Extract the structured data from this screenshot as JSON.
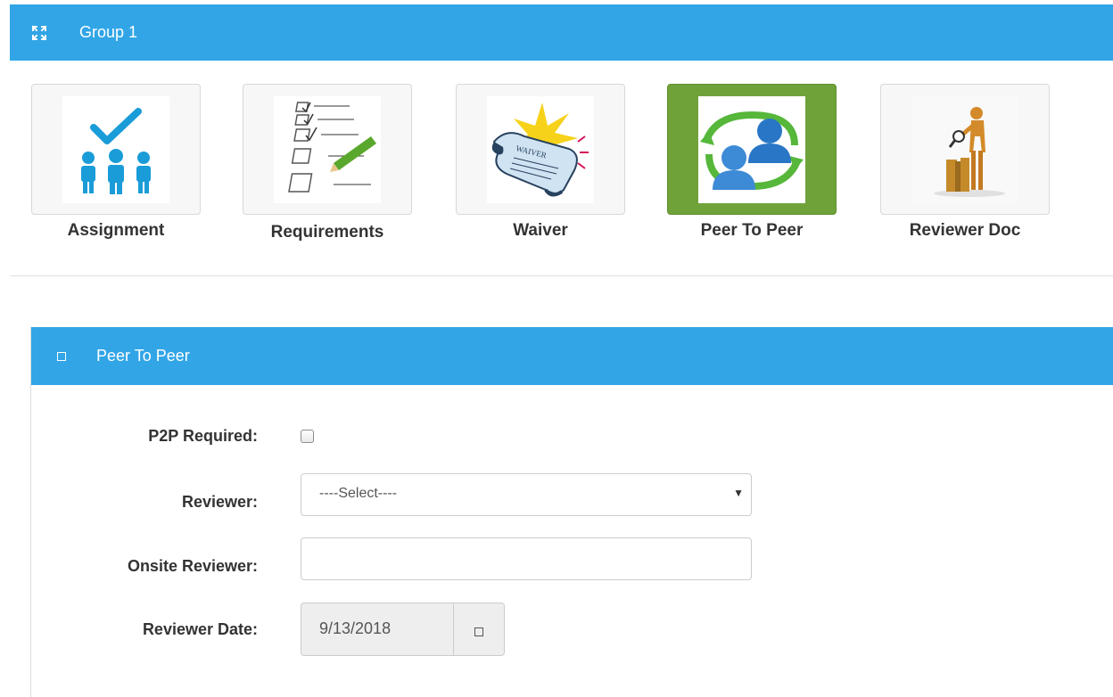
{
  "group": {
    "title": "Group 1",
    "icon": "expand-icon"
  },
  "tiles": [
    {
      "label": "Assignment",
      "icon": "assignment-icon",
      "active": false
    },
    {
      "label": "Requirements",
      "icon": "requirements-icon",
      "active": false
    },
    {
      "label": "Waiver",
      "icon": "waiver-icon",
      "active": false
    },
    {
      "label": "Peer To Peer",
      "icon": "peer-to-peer-icon",
      "active": true
    },
    {
      "label": "Reviewer Doc",
      "icon": "reviewer-doc-icon",
      "active": false
    }
  ],
  "panel": {
    "title": "Peer To Peer",
    "icon": "panel-square-icon"
  },
  "form": {
    "p2p_required_label": "P2P Required:",
    "p2p_required_checked": false,
    "reviewer_label": "Reviewer:",
    "reviewer_value": "----Select----",
    "onsite_reviewer_label": "Onsite Reviewer:",
    "onsite_reviewer_value": "",
    "reviewer_date_label": "Reviewer Date:",
    "reviewer_date_value": "9/13/2018"
  },
  "colors": {
    "header_blue": "#31a5e6",
    "active_tile_green": "#6fa33a"
  },
  "waiver_text": "WAIVER"
}
